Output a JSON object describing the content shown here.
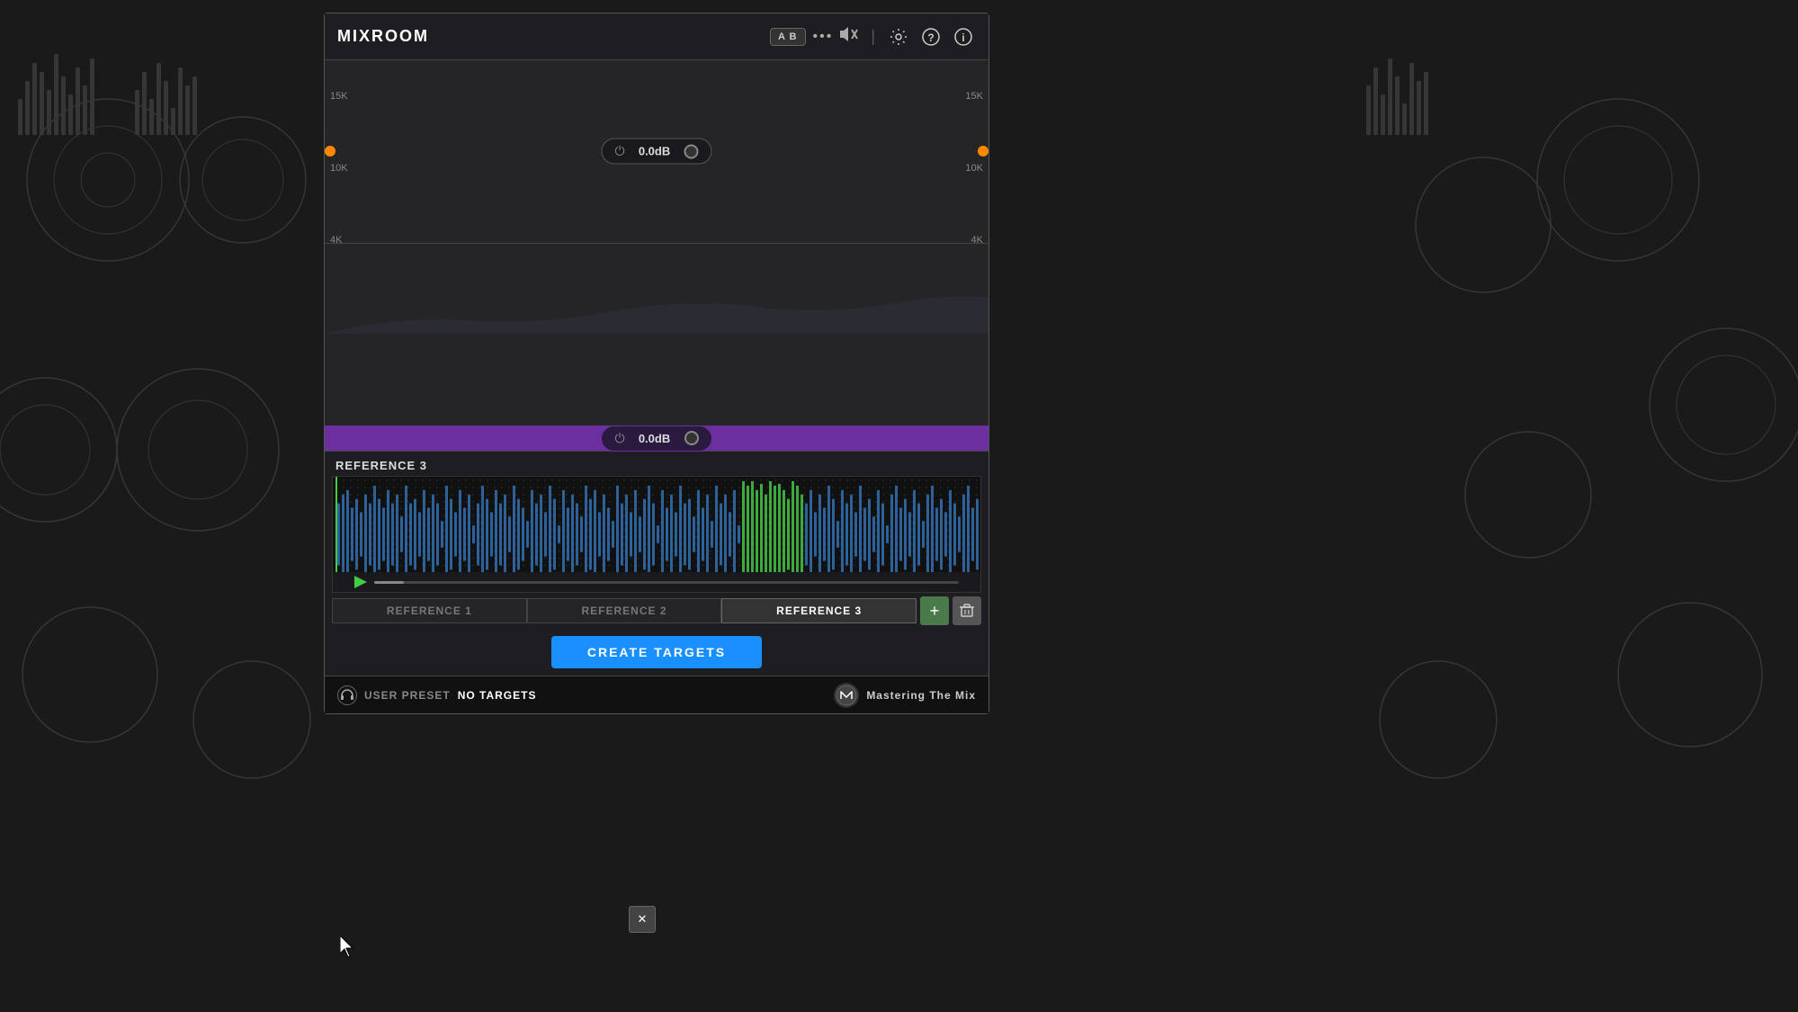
{
  "app": {
    "title": "MIXROOM",
    "background_color": "#1a1a1a"
  },
  "title_bar": {
    "title": "MIXROOM",
    "ab_label": "A B",
    "dots_label": "•••",
    "mute_label": "🔇",
    "settings_icon": "⚙",
    "help_icon": "?",
    "info_icon": "i"
  },
  "freq_labels": {
    "left": [
      "15K",
      "10K",
      "4K"
    ],
    "right": [
      "15K",
      "10K",
      "4K"
    ]
  },
  "vol_control_top": {
    "value": "0.0dB"
  },
  "vol_control_bottom": {
    "value": "0.0dB"
  },
  "reference_panel": {
    "header": "REFERENCE 3",
    "playback_progress": 5
  },
  "tabs": [
    {
      "id": "ref1",
      "label": "REFERENCE 1",
      "active": false
    },
    {
      "id": "ref2",
      "label": "REFERENCE 2",
      "active": false
    },
    {
      "id": "ref3",
      "label": "REFERENCE 3",
      "active": true
    }
  ],
  "buttons": {
    "create_targets": "CREATE TARGETS",
    "add": "+",
    "delete": "🗑",
    "close": "✕"
  },
  "status_bar": {
    "preset_label": "USER PRESET",
    "targets_label": "NO TARGETS",
    "brand_label": "Mastering The Mix"
  },
  "waveform": {
    "blue_color": "#4488cc",
    "green_color": "#44bb44",
    "dark_bg": "#111111"
  }
}
